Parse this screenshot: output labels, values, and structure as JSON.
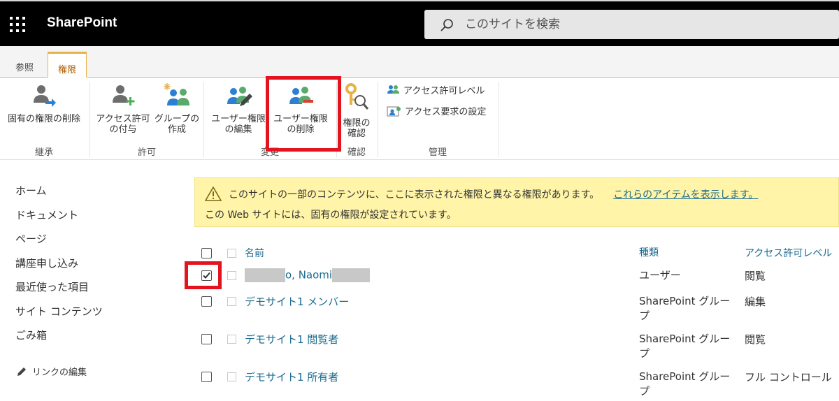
{
  "suite": {
    "brand": "SharePoint",
    "search_placeholder": "このサイトを検索"
  },
  "ribbon": {
    "tabs": [
      {
        "label": "参照"
      },
      {
        "label": "権限"
      }
    ],
    "buttons": {
      "stop_inheritance": "固有の権限の削除",
      "grant_permissions_l1": "アクセス許可",
      "grant_permissions_l2": "の付与",
      "create_group_l1": "グループの",
      "create_group_l2": "作成",
      "edit_user_l1": "ユーザー権限",
      "edit_user_l2": "の編集",
      "remove_user_l1": "ユーザー権限",
      "remove_user_l2": "の削除",
      "check_permissions_l1": "権限の",
      "check_permissions_l2": "確認",
      "permission_levels": "アクセス許可レベル",
      "access_request_settings": "アクセス要求の設定"
    },
    "groups": {
      "inheritance": "継承",
      "grant": "許可",
      "modify": "変更",
      "check": "確認",
      "manage": "管理"
    }
  },
  "nav": {
    "items": [
      "ホーム",
      "ドキュメント",
      "ページ",
      "講座申し込み",
      "最近使った項目",
      "サイト コンテンツ",
      "ごみ箱"
    ],
    "edit_links": "リンクの編集"
  },
  "banner": {
    "line1": "このサイトの一部のコンテンツに、ここに表示された権限と異なる権限があります。",
    "line1_link": "これらのアイテムを表示します。",
    "line2": "この Web サイトには、固有の権限が設定されています。"
  },
  "table": {
    "headers": {
      "name": "名前",
      "type": "種類",
      "permission": "アクセス許可レベル"
    },
    "rows": [
      {
        "name_visible": "o, Naomi",
        "type": "ユーザー",
        "permission": "閲覧",
        "checked": true
      },
      {
        "name": "デモサイト1 メンバー",
        "type": "SharePoint グループ",
        "permission": "編集",
        "checked": false
      },
      {
        "name": "デモサイト1 閲覧者",
        "type": "SharePoint グループ",
        "permission": "閲覧",
        "checked": false
      },
      {
        "name": "デモサイト1 所有者",
        "type": "SharePoint グループ",
        "permission": "フル コントロール",
        "checked": false
      }
    ]
  },
  "colors": {
    "accent_orange": "#e8b24b",
    "link_teal": "#1a6b8f",
    "highlight_red": "#e3141f",
    "banner_yellow": "#fff4a8"
  }
}
